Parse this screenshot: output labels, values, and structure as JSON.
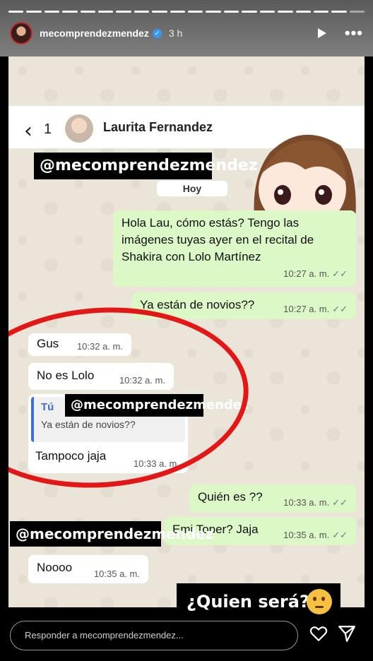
{
  "story": {
    "username": "mecomprendezmendez",
    "time_ago": "3 h",
    "progress_segments": 20,
    "progress_viewed": 19
  },
  "chat": {
    "back_count": "1",
    "contact_name": "Laurita Fernandez",
    "day_label": "Hoy",
    "messages": [
      {
        "dir": "out",
        "text": "Hola Lau, cómo estás? Tengo las imágenes tuyas ayer en el recital de Shakira con Lolo Martínez",
        "time": "10:27 a. m."
      },
      {
        "dir": "out",
        "text": "Ya están de novios??",
        "time": "10:27 a. m."
      },
      {
        "dir": "in",
        "text": "Gus",
        "time": "10:32 a. m."
      },
      {
        "dir": "in",
        "text": "No es Lolo",
        "time": "10:32 a. m."
      },
      {
        "dir": "in",
        "quote_name": "Tú",
        "quote_text": "Ya están de novios??",
        "text": "Tampoco jaja",
        "time": "10:33 a. m."
      },
      {
        "dir": "out",
        "text": "Quién es ??",
        "time": "10:33 a. m."
      },
      {
        "dir": "out",
        "text": "Emi Toper? Jaja",
        "time": "10:35 a. m."
      },
      {
        "dir": "in",
        "text": "Noooo",
        "time": "10:35 a. m."
      }
    ],
    "watermark": "@mecomprendezmendez"
  },
  "caption": "¿Quien será?",
  "footer": {
    "reply_placeholder": "Responder a mecomprendezmendez..."
  },
  "colors": {
    "outgoing_bubble": "#dcf8c6",
    "incoming_bubble": "#ffffff",
    "annotation_circle": "#e51616",
    "quote_accent": "#3a6fd6"
  }
}
